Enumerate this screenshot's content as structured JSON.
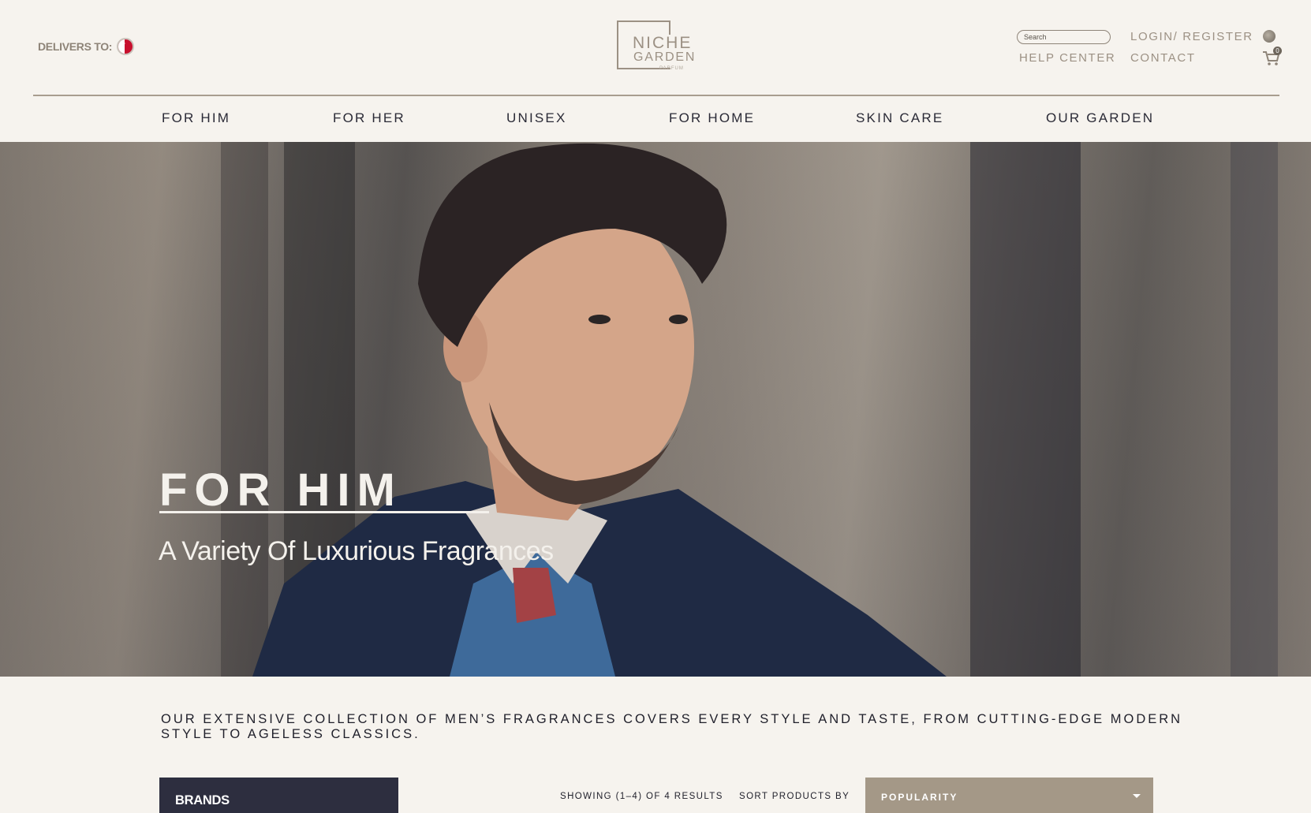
{
  "header": {
    "delivers_label": "DELIVERS TO:",
    "logo": {
      "line1": "NICHE",
      "line2": "GARDEN",
      "line3": "PARFUM"
    },
    "search_placeholder": "Search",
    "login_label": "LOGIN/ REGISTER",
    "help_label": "HELP CENTER",
    "contact_label": "CONTACT",
    "cart_count": "0"
  },
  "nav": {
    "items": [
      "FOR HIM",
      "FOR HER",
      "UNISEX",
      "FOR HOME",
      "SKIN CARE",
      "OUR GARDEN"
    ]
  },
  "hero": {
    "title": "FOR HIM",
    "subtitle": "A Variety Of Luxurious Fragrances"
  },
  "content": {
    "intro": "OUR EXTENSIVE COLLECTION OF MEN’S FRAGRANCES COVERS EVERY STYLE AND TASTE, FROM CUTTING-EDGE MODERN STYLE TO AGELESS CLASSICS.",
    "brands_label": "BRANDS",
    "showing": "SHOWING (1–4) OF 4 RESULTS",
    "sort_label": "SORT PRODUCTS BY",
    "sort_value": "POPULARITY"
  },
  "colors": {
    "background": "#f6f3ee",
    "accent": "#a49887",
    "dark": "#2d2e3f",
    "text": "#2a2a36"
  }
}
